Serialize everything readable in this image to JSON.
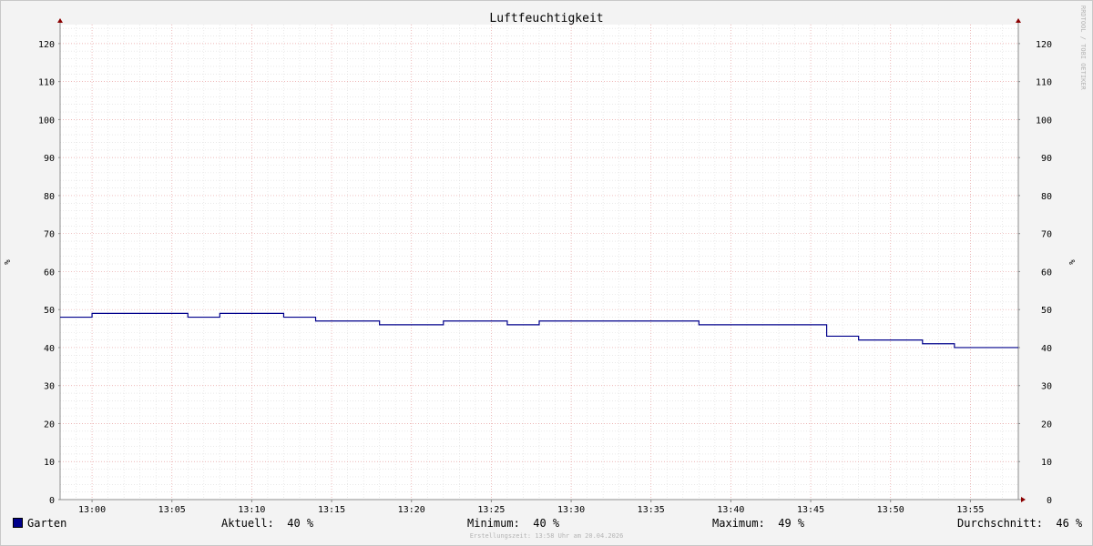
{
  "chart_data": {
    "type": "line",
    "title": "Luftfeuchtigkeit",
    "ylabel_left": "%",
    "ylabel_right": "%",
    "ylim": [
      0,
      125
    ],
    "yticks": [
      0,
      10,
      20,
      30,
      40,
      50,
      60,
      70,
      80,
      90,
      100,
      110,
      120
    ],
    "xlim": [
      "12:58",
      "13:58"
    ],
    "xticks": [
      "13:00",
      "13:05",
      "13:10",
      "13:15",
      "13:20",
      "13:25",
      "13:30",
      "13:35",
      "13:40",
      "13:45",
      "13:50",
      "13:55"
    ],
    "grid": true,
    "series": [
      {
        "name": "Garten",
        "color": "#00008b",
        "step": true,
        "points": [
          [
            "12:58",
            48
          ],
          [
            "13:00",
            49
          ],
          [
            "13:06",
            48
          ],
          [
            "13:08",
            49
          ],
          [
            "13:12",
            48
          ],
          [
            "13:14",
            47
          ],
          [
            "13:18",
            46
          ],
          [
            "13:22",
            47
          ],
          [
            "13:26",
            46
          ],
          [
            "13:28",
            47
          ],
          [
            "13:38",
            46
          ],
          [
            "13:46",
            43
          ],
          [
            "13:48",
            42
          ],
          [
            "13:52",
            41
          ],
          [
            "13:54",
            40
          ],
          [
            "13:58",
            40
          ]
        ]
      }
    ],
    "watermark": "RRDTOOL / TOBI OETIKER"
  },
  "legend": {
    "series_name": "Garten",
    "current": "Aktuell:  40 %",
    "minimum": "Minimum:  40 %",
    "maximum": "Maximum:  49 %",
    "average": "Durchschnitt:  46 %"
  },
  "footer": "Erstellungszeit: 13:58 Uhr am 20.04.2026"
}
